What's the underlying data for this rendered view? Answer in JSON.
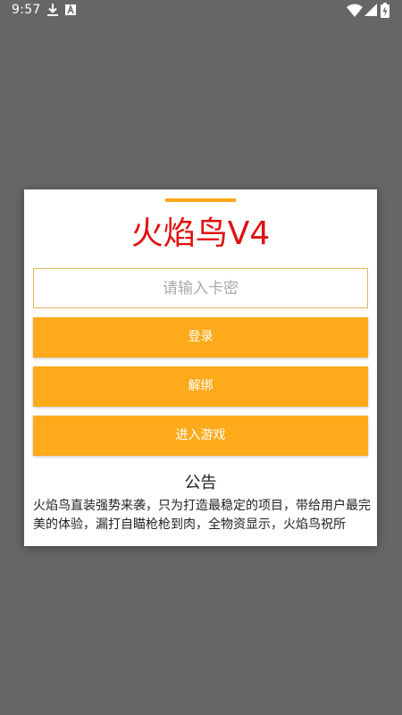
{
  "status_bar": {
    "time": "9:57",
    "icons": [
      "download-icon",
      "a-icon",
      "wifi-icon",
      "signal-icon",
      "battery-icon"
    ]
  },
  "dialog": {
    "title": "火焰鸟V4",
    "card_input": {
      "value": "",
      "placeholder": "请输入卡密"
    },
    "buttons": {
      "login": "登录",
      "unbind": "解绑",
      "enter_game": "进入游戏"
    },
    "notice": {
      "title": "公告",
      "body": "火焰鸟直装强势来袭，只为打造最稳定的项目，带给用户最完美的体验，漏打自瞄枪枪到肉，全物资显示，火焰鸟祝所"
    }
  },
  "colors": {
    "accent": "#ffaa1a",
    "title": "#e01010",
    "backdrop": "#666666"
  }
}
